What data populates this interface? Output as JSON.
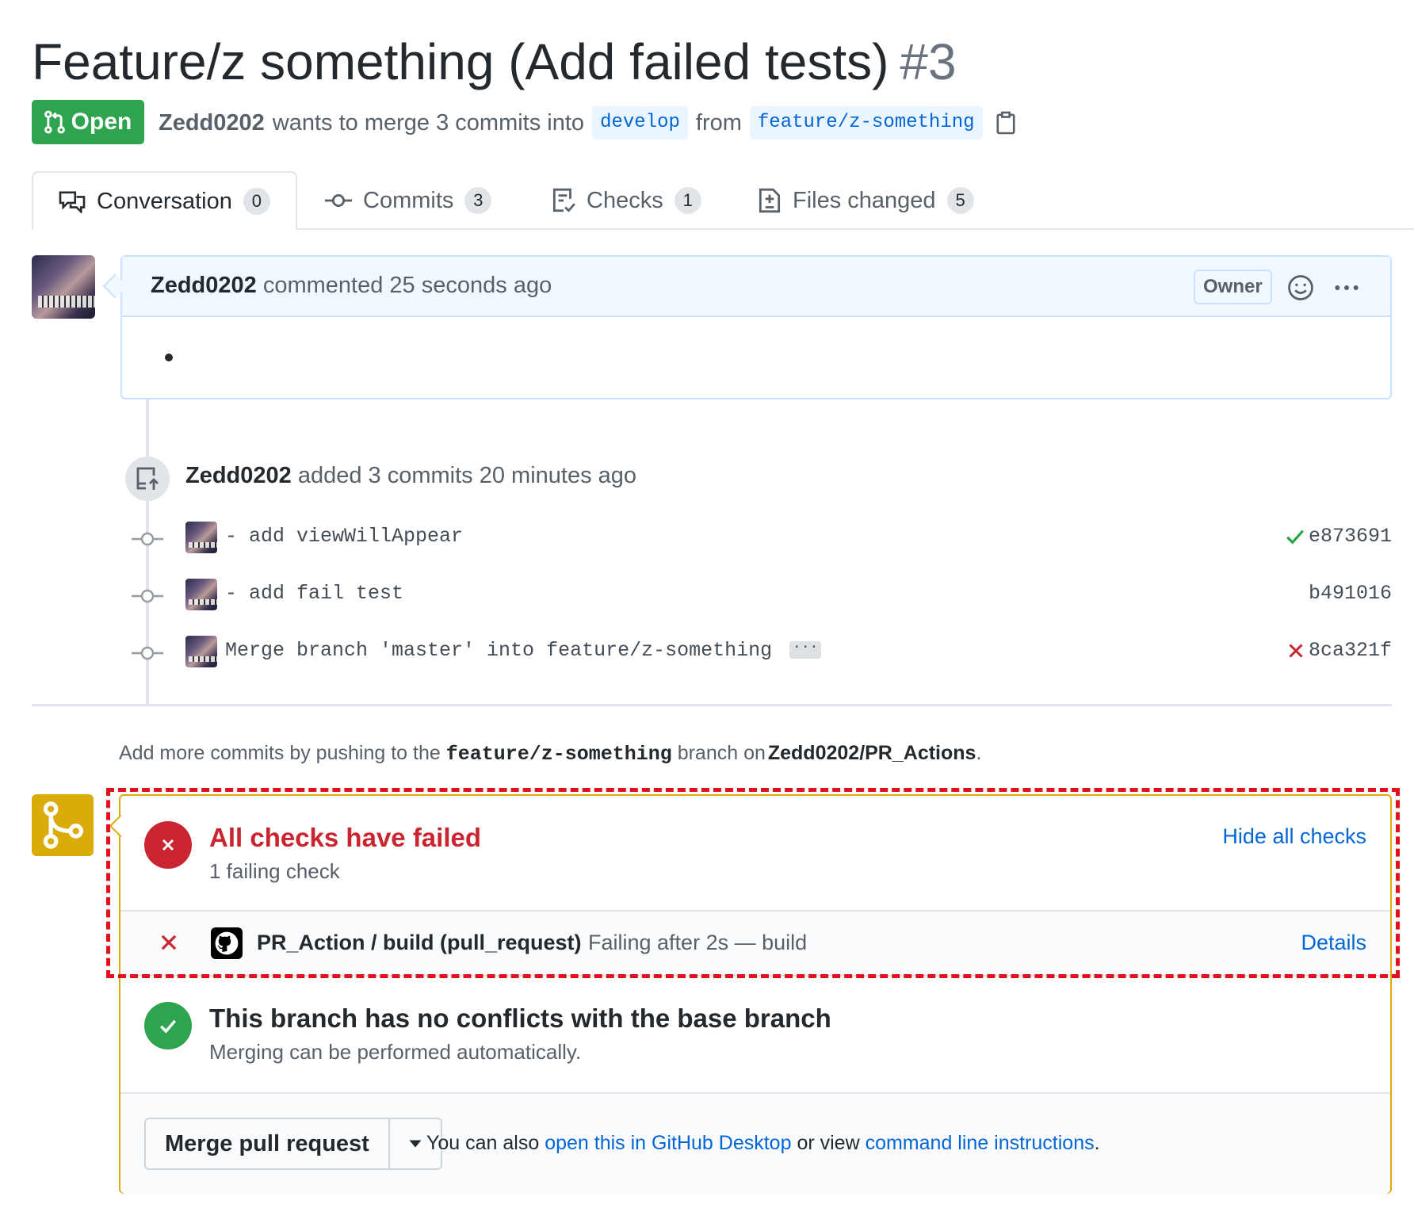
{
  "pr": {
    "title": "Feature/z something (Add failed tests)",
    "number": "#3",
    "state": "Open",
    "author": "Zedd0202",
    "merge_text": "wants to merge 3 commits into",
    "base_branch": "develop",
    "from_text": "from",
    "head_branch": "feature/z-something"
  },
  "tabs": [
    {
      "label": "Conversation",
      "count": "0",
      "icon": "comment-discussion-icon"
    },
    {
      "label": "Commits",
      "count": "3",
      "icon": "git-commit-icon"
    },
    {
      "label": "Checks",
      "count": "1",
      "icon": "checklist-icon"
    },
    {
      "label": "Files changed",
      "count": "5",
      "icon": "diff-icon"
    }
  ],
  "comment": {
    "author": "Zedd0202",
    "action": "commented 25 seconds ago",
    "role_badge": "Owner"
  },
  "commits_event": {
    "author": "Zedd0202",
    "text": "added 3 commits 20 minutes ago"
  },
  "commits": [
    {
      "message": "- add viewWillAppear",
      "sha": "e873691",
      "status": "success"
    },
    {
      "message": "- add fail test",
      "sha": "b491016",
      "status": "none"
    },
    {
      "message": "Merge branch 'master' into feature/z-something",
      "sha": "8ca321f",
      "status": "failure",
      "has_more": true
    }
  ],
  "push_hint": {
    "prefix": "Add more commits by pushing to the",
    "branch": "feature/z-something",
    "middle": "branch on",
    "repo": "Zedd0202/PR_Actions",
    "suffix": "."
  },
  "checks": {
    "title": "All checks have failed",
    "subtitle": "1 failing check",
    "toggle_label": "Hide all checks",
    "items": [
      {
        "name": "PR_Action / build (pull_request)",
        "description": "Failing after 2s — build",
        "details_label": "Details",
        "status": "failure"
      }
    ]
  },
  "conflicts": {
    "title": "This branch has no conflicts with the base branch",
    "subtitle": "Merging can be performed automatically."
  },
  "merge": {
    "button_label": "Merge pull request",
    "help_prefix": "You can also",
    "desktop_link": "open this in GitHub Desktop",
    "help_middle": "or view",
    "cli_link": "command line instructions",
    "help_suffix": "."
  },
  "colors": {
    "open_green": "#2ea44f",
    "failure_red": "#cb2431",
    "link_blue": "#0366d6",
    "merge_yellow": "#dbab09",
    "highlight_red": "#e3101c"
  }
}
